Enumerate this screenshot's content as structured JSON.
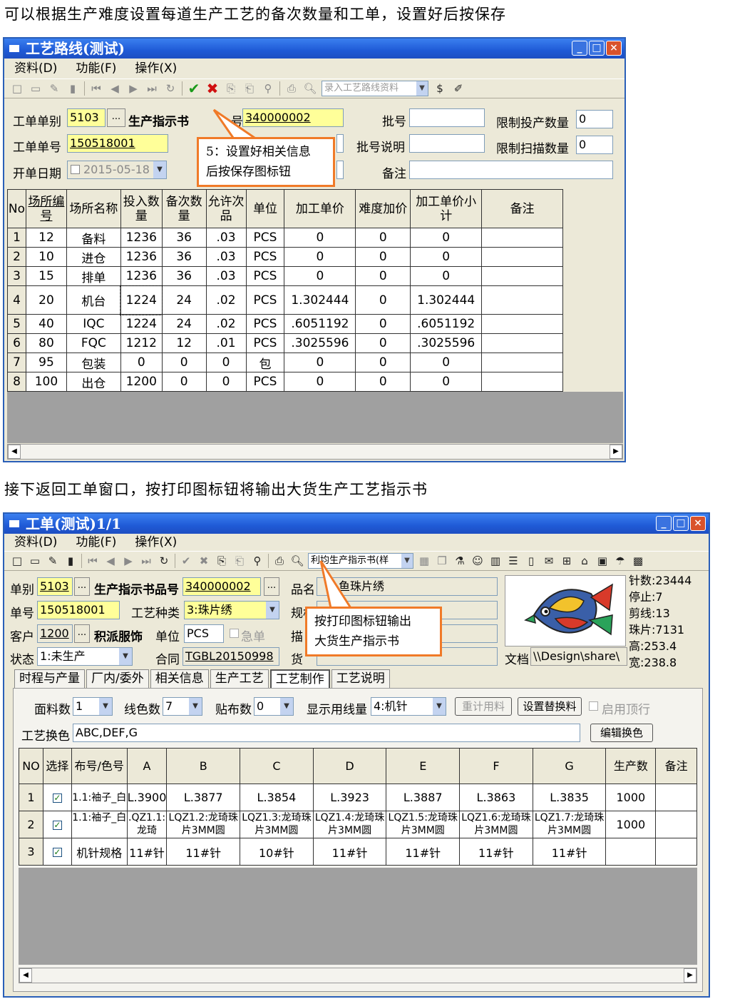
{
  "caption1": "可以根据生产难度设置每道生产工艺的备次数量和工单，设置好后按保存",
  "caption2": "接下返回工单窗口，按打印图标钮将输出大货生产工艺指示书",
  "win1": {
    "title": "工艺路线(测试)",
    "menu": [
      "资料(D)",
      "功能(F)",
      "操作(X)"
    ],
    "toolbar_combo": "录入工艺路线资料",
    "fields": {
      "type_label": "工单单别",
      "type_value": "5103",
      "ellipsis": "...",
      "guide_label": "生产指示书",
      "guide_code_label_tail": "号",
      "guide_value": "340000002",
      "batch_label": "批号",
      "batch_value": "",
      "limit_prod_label": "限制投产数量",
      "limit_prod_value": "0",
      "order_label": "工单单号",
      "order_value": "150518001",
      "batch_desc_label": "批号说明",
      "batch_desc_value": "",
      "limit_scan_label": "限制扫描数量",
      "limit_scan_value": "0",
      "date_label": "开单日期",
      "date_value": "2015-05-18",
      "note_label": "备注",
      "note_value": ""
    },
    "grid": {
      "headers": [
        "No",
        "场所编号",
        "场所名称",
        "投入数量",
        "备次数量",
        "允许次品",
        "单位",
        "加工单价",
        "难度加价",
        "加工单价小计",
        "备注"
      ],
      "rows": [
        [
          "1",
          "12",
          "备料",
          "1236",
          "36",
          ".03",
          "PCS",
          "0",
          "0",
          "0",
          ""
        ],
        [
          "2",
          "10",
          "进仓",
          "1236",
          "36",
          ".03",
          "PCS",
          "0",
          "0",
          "0",
          ""
        ],
        [
          "3",
          "15",
          "排单",
          "1236",
          "36",
          ".03",
          "PCS",
          "0",
          "0",
          "0",
          ""
        ],
        [
          "4",
          "20",
          "机台",
          "1224",
          "24",
          ".02",
          "PCS",
          "1.302444",
          "0",
          "1.302444",
          ""
        ],
        [
          "5",
          "40",
          "IQC",
          "1224",
          "24",
          ".02",
          "PCS",
          ".6051192",
          "0",
          ".6051192",
          ""
        ],
        [
          "6",
          "80",
          "FQC",
          "1212",
          "12",
          ".01",
          "PCS",
          ".3025596",
          "0",
          ".3025596",
          ""
        ],
        [
          "7",
          "95",
          "包装",
          "0",
          "0",
          "0",
          "包",
          "0",
          "0",
          "0",
          ""
        ],
        [
          "8",
          "100",
          "出仓",
          "1200",
          "0",
          "0",
          "PCS",
          "0",
          "0",
          "0",
          ""
        ]
      ]
    },
    "callout": [
      "5：设置好相关信息",
      "后按保存图标钮"
    ]
  },
  "win2": {
    "title": "工单(测试)1/1",
    "menu": [
      "资料(D)",
      "功能(F)",
      "操作(X)"
    ],
    "toolbar_combo": "利均生产指示书(样",
    "fields": {
      "type_label": "单别",
      "type_value": "5103",
      "guide_label": "生产指示书品号",
      "guide_value": "340000002",
      "name_label": "品名",
      "name_value": "鱼珠片绣",
      "order_label": "单号",
      "order_value": "150518001",
      "craft_label": "工艺种类",
      "craft_value": "3:珠片绣",
      "spec_label": "规格",
      "customer_label": "客户",
      "customer_value": "1200",
      "customer_name": "积派服饰",
      "unit_label": "单位",
      "unit_value": "PCS",
      "urgent_label": "急单",
      "desc_label": "描",
      "status_label": "状态",
      "status_value": "1:未生产",
      "contract_label": "合同",
      "contract_value": "TGBL20150998",
      "goods_label": "货",
      "doc_label": "文档",
      "doc_value": "\\\\Design\\share\\"
    },
    "stats": [
      "针数:23444",
      "停止:7",
      "剪线:13",
      "珠片:7131",
      "高:253.4",
      "宽:238.8"
    ],
    "tabs": [
      "时程与产量",
      "厂内/委外",
      "相关信息",
      "生产工艺",
      "工艺制作",
      "工艺说明"
    ],
    "active_tab": 4,
    "opts": {
      "fabric_label": "面料数",
      "fabric_value": "1",
      "thread_label": "线色数",
      "thread_value": "7",
      "patch_label": "贴布数",
      "patch_value": "0",
      "show_label": "显示用线量",
      "show_value": "4:机针",
      "recalc": "重计用料",
      "replace": "设置替换料",
      "top_label": "启用顶行",
      "swap_label": "工艺换色",
      "swap_value": "ABC,DEF,G",
      "edit_swap": "编辑换色"
    },
    "grid": {
      "headers": [
        "NO",
        "选择",
        "布号/色号",
        "A",
        "B",
        "C",
        "D",
        "E",
        "F",
        "G",
        "生产数",
        "备注"
      ],
      "rows": [
        [
          "1",
          true,
          "1.1:袖子_白",
          "L.3900",
          "L.3877",
          "L.3854",
          "L.3923",
          "L.3887",
          "L.3863",
          "L.3835",
          "1000",
          ""
        ],
        [
          "2",
          true,
          "1.1:袖子_白",
          ".QZ1.1:龙琦",
          "LQZ1.2:龙琦珠片3MM圆",
          "LQZ1.3:龙琦珠片3MM圆",
          "LQZ1.4:龙琦珠片3MM圆",
          "LQZ1.5:龙琦珠片3MM圆",
          "LQZ1.6:龙琦珠片3MM圆",
          "LQZ1.7:龙琦珠片3MM圆",
          "1000",
          ""
        ],
        [
          "3",
          true,
          "机针规格",
          "11#针",
          "11#针",
          "10#针",
          "11#针",
          "11#针",
          "11#针",
          "11#针",
          "",
          ""
        ]
      ]
    },
    "callout": [
      "按打印图标钮输出",
      "大货生产指示书"
    ]
  }
}
